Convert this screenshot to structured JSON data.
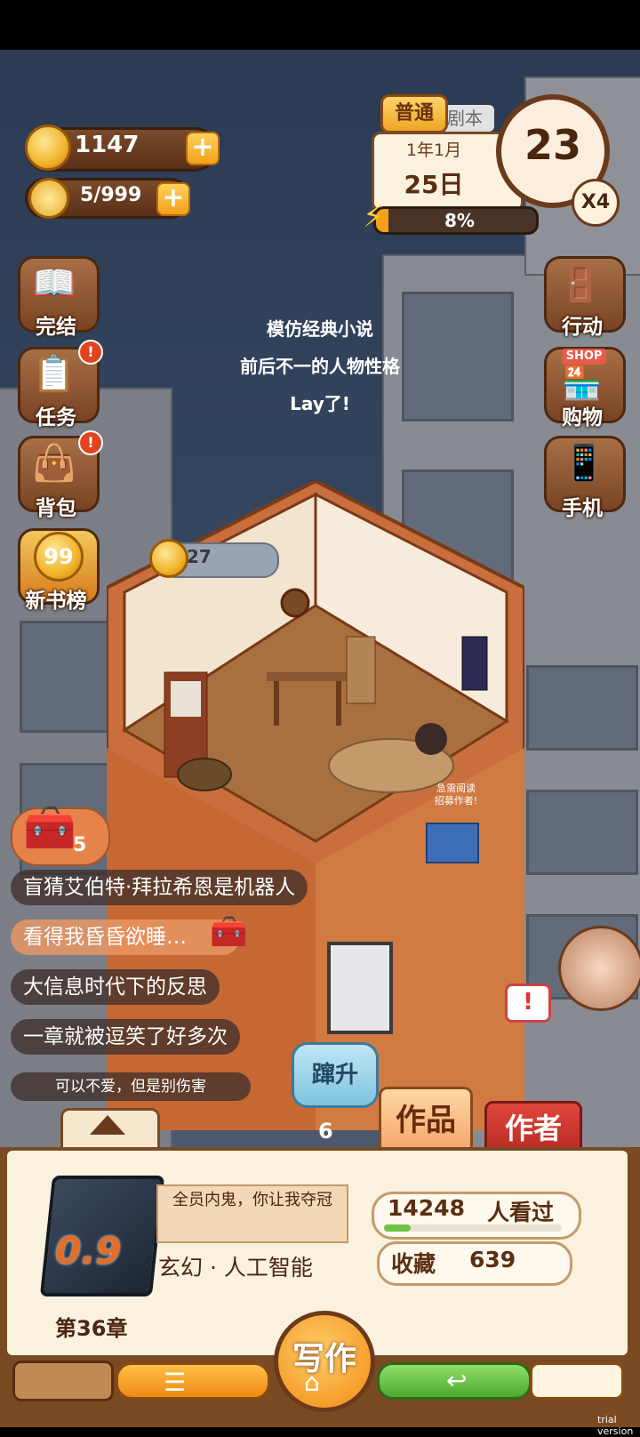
{
  "hud": {
    "coins": "1147",
    "energy": "5/999",
    "difficulty": "普通",
    "difficulty_under": "剧本",
    "date_month": "1年1月",
    "date_day": "25日",
    "clock_value": "23",
    "speed": "X4",
    "progress_text": "8%",
    "progress": 0.08
  },
  "left_menu": [
    {
      "label": "完结",
      "icon": "book-icon"
    },
    {
      "label": "任务",
      "icon": "checklist-icon",
      "badge": "!"
    },
    {
      "label": "背包",
      "icon": "bag-icon",
      "badge": "!"
    },
    {
      "label": "新书榜",
      "icon": "ranking-99-icon",
      "badge_num": "99"
    }
  ],
  "right_menu": [
    {
      "label": "行动",
      "icon": "door-icon"
    },
    {
      "label": "购物",
      "icon": "shop-icon",
      "sign": "SHOP"
    },
    {
      "label": "手机",
      "icon": "phone-icon"
    }
  ],
  "caption_lines": [
    "模仿经典小说",
    "前后不一的人物性格",
    "Lay了!"
  ],
  "room": {
    "coin_bubble": "27",
    "poster": "急需阅读\n招募作者!"
  },
  "chest_count": "5",
  "comments": [
    "盲猜艾伯特·拜拉希恩是机器人",
    "看得我昏昏欲睡…",
    "大信息时代下的反思",
    "一章就被逗笑了好多次",
    "可以不爱，但是别伤害"
  ],
  "rise_button": {
    "label": "蹿升",
    "count": "6"
  },
  "tabs": {
    "works": "作品",
    "author": "作者"
  },
  "book": {
    "cover_rating": "0.9",
    "title": "全员内鬼，你让我夺冠",
    "genre": "玄幻 · 人工智能",
    "chapter": "第36章",
    "views_count": "14248",
    "views_label": "人看过",
    "favorites_label": "收藏",
    "favorites_count": "639",
    "views_progress": 0.15
  },
  "write_button": "写作",
  "watermark": "trial version",
  "colors": {
    "orange": "#f3a11b",
    "green": "#6ec244",
    "brown": "#6b3a1c",
    "cream": "#fbf1df",
    "red": "#d9362e"
  }
}
